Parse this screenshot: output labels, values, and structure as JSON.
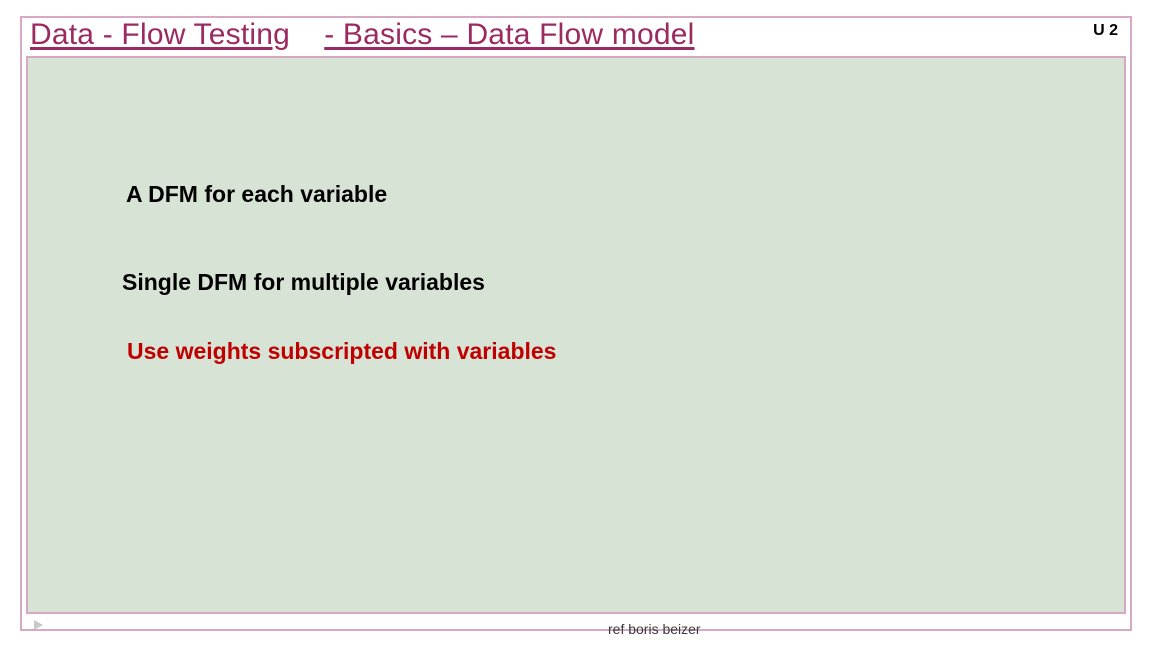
{
  "title_part1": "Data - Flow Testing",
  "title_part2": "-  Basics – Data Flow model",
  "badge": "U 2",
  "body": {
    "line1": "A DFM for each variable",
    "line2": "Single DFM for multiple variables",
    "line3": "Use weights subscripted with variables"
  },
  "footer": "ref boris beizer"
}
